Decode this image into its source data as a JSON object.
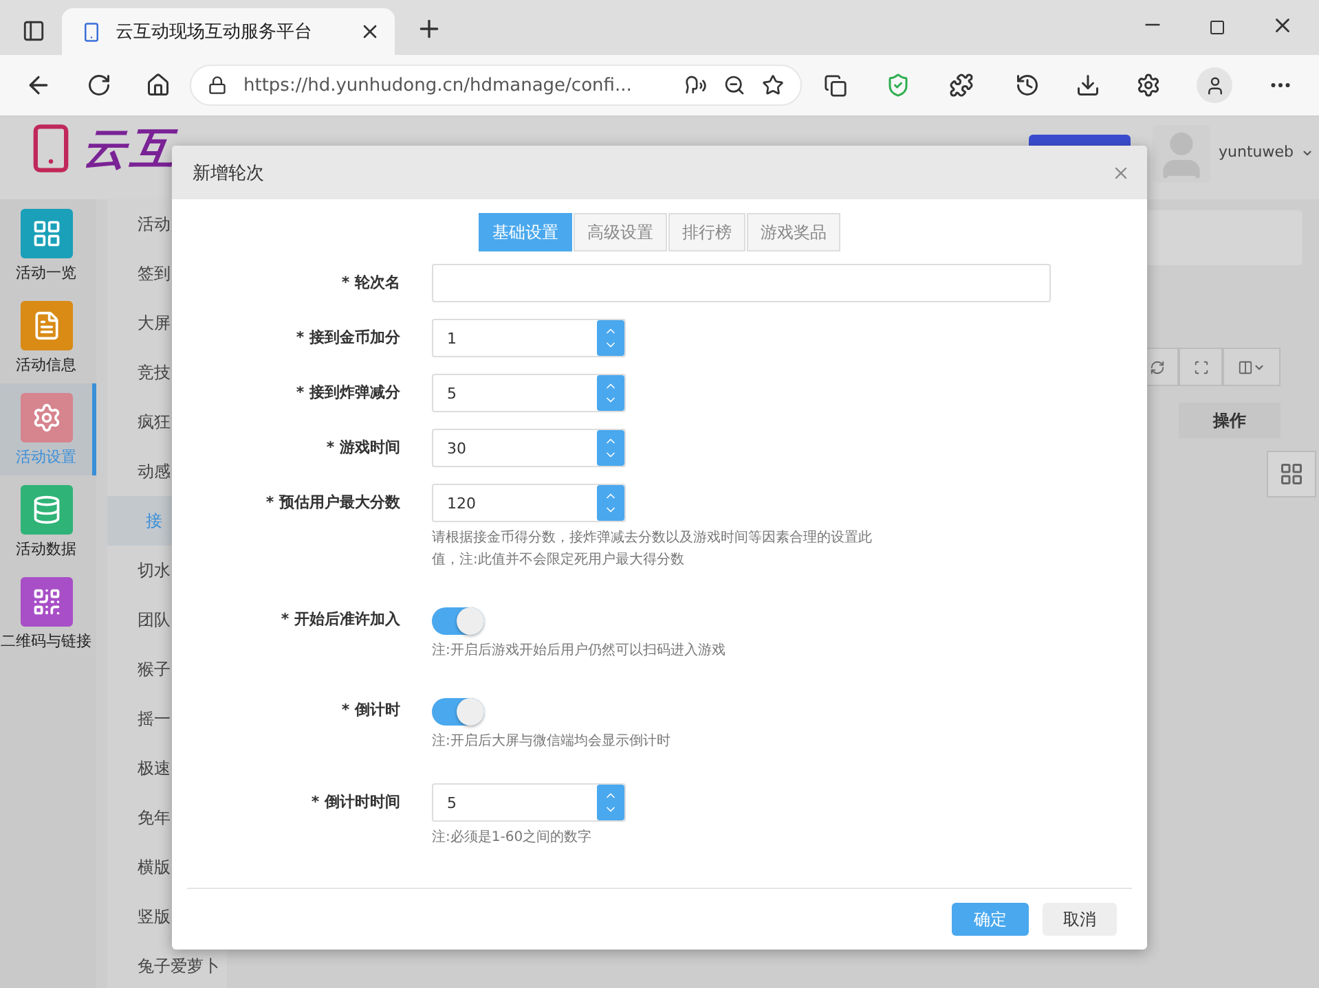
{
  "browser": {
    "tab_title": "云互动现场互动服务平台",
    "url": "https://hd.yunhudong.cn/hdmanage/confi..."
  },
  "header": {
    "logo": "云互",
    "user": "yuntuweb"
  },
  "sidebar": {
    "items": [
      {
        "label": "活动一览",
        "selected": false,
        "color": "#1aa0b8",
        "kind": "grid"
      },
      {
        "label": "活动信息",
        "selected": false,
        "color": "#d98b16",
        "kind": "file"
      },
      {
        "label": "活动设置",
        "selected": true,
        "color": "#d6848e",
        "kind": "gear"
      },
      {
        "label": "活动数据",
        "selected": false,
        "color": "#2fb377",
        "kind": "database"
      },
      {
        "label": "二维码与链接",
        "selected": false,
        "color": "#a84fc7",
        "kind": "qr"
      }
    ]
  },
  "submenu": {
    "items": [
      {
        "label": "活动",
        "selected": false
      },
      {
        "label": "签到",
        "selected": false
      },
      {
        "label": "大屏",
        "selected": false
      },
      {
        "label": "竞技",
        "selected": false
      },
      {
        "label": "疯狂",
        "selected": false
      },
      {
        "label": "动感",
        "selected": false
      },
      {
        "label": "接",
        "selected": true
      },
      {
        "label": "切水",
        "selected": false
      },
      {
        "label": "团队",
        "selected": false
      },
      {
        "label": "猴子",
        "selected": false
      },
      {
        "label": "摇一",
        "selected": false
      },
      {
        "label": "极速",
        "selected": false
      },
      {
        "label": "免年",
        "selected": false
      },
      {
        "label": "横版",
        "selected": false
      },
      {
        "label": "竖版",
        "selected": false
      },
      {
        "label": "兔子爱萝卜",
        "selected": false
      }
    ]
  },
  "table": {
    "columns": [
      "操作"
    ]
  },
  "dialog": {
    "title": "新增轮次",
    "tabs": [
      {
        "label": "基础设置",
        "selected": true
      },
      {
        "label": "高级设置",
        "selected": false
      },
      {
        "label": "排行榜",
        "selected": false
      },
      {
        "label": "游戏奖品",
        "selected": false
      }
    ],
    "fields": [
      {
        "kind": "text",
        "label": "* 轮次名"
      },
      {
        "kind": "number",
        "label": "* 接到金币加分",
        "value": "1"
      },
      {
        "kind": "number",
        "label": "* 接到炸弹减分",
        "value": "5"
      },
      {
        "kind": "number",
        "label": "* 游戏时间",
        "value": "30"
      },
      {
        "kind": "number",
        "label": "* 预估用户最大分数",
        "value": "120",
        "note": "请根据接金币得分数，接炸弹减去分数以及游戏时间等因素合理的设置此值，注:此值并不会限定死用户最大得分数"
      },
      {
        "kind": "toggle",
        "label": "* 开始后准许加入",
        "on": true,
        "note": "注:开启后游戏开始后用户仍然可以扫码进入游戏"
      },
      {
        "kind": "toggle",
        "label": "* 倒计时",
        "on": true,
        "note": "注:开启后大屏与微信端均会显示倒计时"
      },
      {
        "kind": "number",
        "label": "* 倒计时时间",
        "value": "5",
        "note": "注:必须是1-60之间的数字"
      }
    ],
    "buttons": [
      {
        "label": "确定",
        "kind": "primary"
      },
      {
        "label": "取消",
        "kind": "secondary"
      }
    ]
  }
}
